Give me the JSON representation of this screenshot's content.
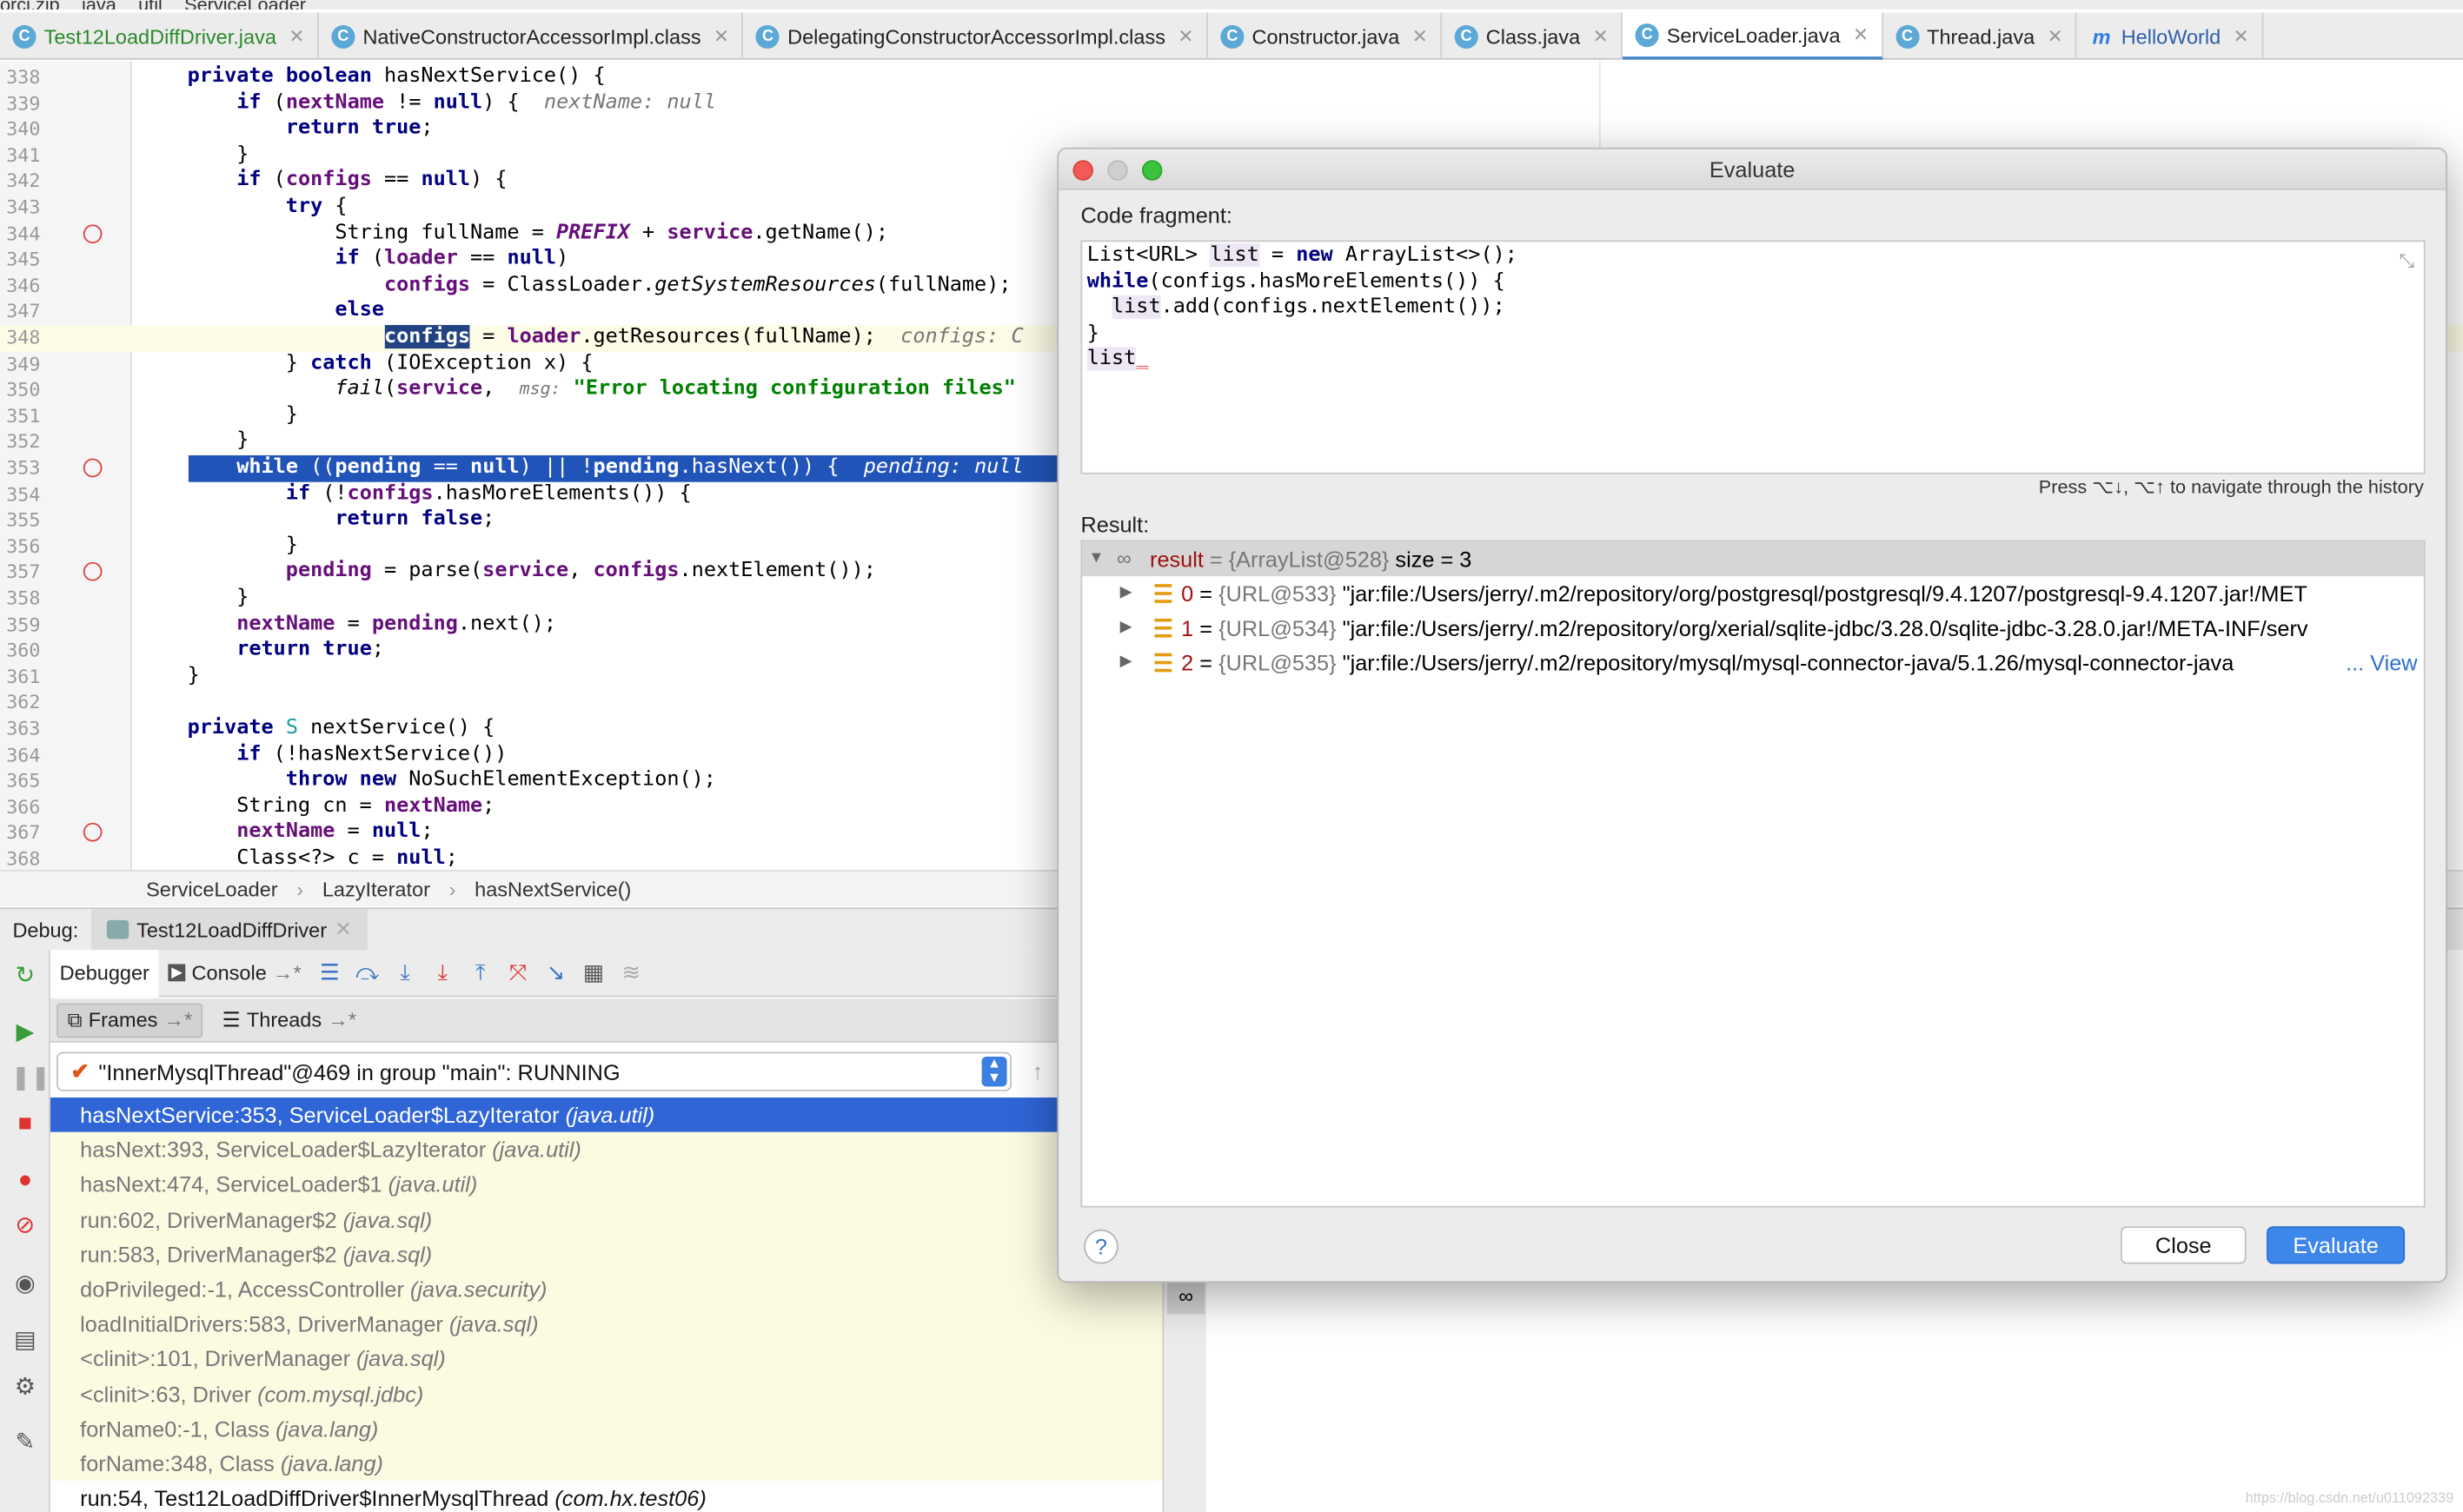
{
  "top_crumbs": [
    "orci.zip",
    "java",
    "util",
    "ServiceLoader"
  ],
  "tabs": [
    {
      "label": "Test12LoadDiffDriver.java",
      "icon": "C",
      "style": "green"
    },
    {
      "label": "NativeConstructorAccessorImpl.class",
      "icon": "C",
      "style": ""
    },
    {
      "label": "DelegatingConstructorAccessorImpl.class",
      "icon": "C",
      "style": ""
    },
    {
      "label": "Constructor.java",
      "icon": "C",
      "style": ""
    },
    {
      "label": "Class.java",
      "icon": "C",
      "style": ""
    },
    {
      "label": "ServiceLoader.java",
      "icon": "C",
      "style": "active"
    },
    {
      "label": "Thread.java",
      "icon": "C",
      "style": ""
    },
    {
      "label": "HelloWorld",
      "icon": "m",
      "style": "blue"
    }
  ],
  "editor": {
    "lines": [
      {
        "n": "338",
        "html": "    <span class='kw'>private boolean</span> hasNextService() {"
      },
      {
        "n": "339",
        "html": "        <span class='kw'>if</span> (<span class='fld'>nextName</span> != <span class='kw'>null</span>) {  <span class='hint'>nextName: null</span>"
      },
      {
        "n": "340",
        "html": "            <span class='kw'>return true</span>;"
      },
      {
        "n": "341",
        "html": "        }"
      },
      {
        "n": "342",
        "html": "        <span class='kw'>if</span> (<span class='fld'>configs</span> == <span class='kw'>null</span>) {"
      },
      {
        "n": "343",
        "html": "            <span class='kw'>try</span> {"
      },
      {
        "n": "344",
        "bp": true,
        "html": "                String fullName = <span class='fld it'>PREFIX</span> + <span class='fld'>service</span>.getName();"
      },
      {
        "n": "345",
        "html": "                <span class='kw'>if</span> (<span class='fld'>loader</span> == <span class='kw'>null</span>)"
      },
      {
        "n": "346",
        "html": "                    <span class='fld'>configs</span> = ClassLoader.<span class='it'>getSystemResources</span>(fullName);"
      },
      {
        "n": "347",
        "html": "                <span class='kw'>else</span>"
      },
      {
        "n": "348",
        "cur": true,
        "html": "                    <span class='fld sel'>configs</span> = <span class='fld'>loader</span>.getResources(fullName);  <span class='hint'>configs: C</span>"
      },
      {
        "n": "349",
        "html": "            } <span class='kw'>catch</span> (IOException x) {"
      },
      {
        "n": "350",
        "html": "                <span class='it'>fail</span>(<span class='fld'>service</span>,  <span class='hint' style='font-size:11px'>msg:</span> <span class='str'>\"Error locating configuration files\"</span>"
      },
      {
        "n": "351",
        "html": "            }"
      },
      {
        "n": "352",
        "html": "        }"
      },
      {
        "n": "353",
        "bp": true,
        "exec": true,
        "html": "        <span class='kw'>while</span> ((<span class='fld'>pending</span> == <span class='kw'>null</span>) || !<span class='fld'>pending</span>.hasNext()) {  <span class='hint'>pending: null</span>"
      },
      {
        "n": "354",
        "html": "            <span class='kw'>if</span> (!<span class='fld'>configs</span>.hasMoreElements()) {"
      },
      {
        "n": "355",
        "html": "                <span class='kw'>return false</span>;"
      },
      {
        "n": "356",
        "html": "            }"
      },
      {
        "n": "357",
        "bp": true,
        "html": "            <span class='fld'>pending</span> = parse(<span class='fld'>service</span>, <span class='fld'>configs</span>.nextElement());"
      },
      {
        "n": "358",
        "html": "        }"
      },
      {
        "n": "359",
        "html": "        <span class='fld'>nextName</span> = <span class='fld'>pending</span>.next();"
      },
      {
        "n": "360",
        "html": "        <span class='kw'>return true</span>;"
      },
      {
        "n": "361",
        "html": "    }"
      },
      {
        "n": "362",
        "html": ""
      },
      {
        "n": "363",
        "html": "    <span class='kw'>private</span> <span style='color:#20999d'>S</span> nextService() {"
      },
      {
        "n": "364",
        "html": "        <span class='kw'>if</span> (!hasNextService())"
      },
      {
        "n": "365",
        "html": "            <span class='kw'>throw new</span> NoSuchElementException();"
      },
      {
        "n": "366",
        "html": "        String cn = <span class='fld'>nextName</span>;"
      },
      {
        "n": "367",
        "bp": true,
        "html": "        <span class='fld'>nextName</span> = <span class='kw'>null</span>;"
      },
      {
        "n": "368",
        "html": "        Class&lt;?&gt; c = <span class='kw'>null</span>;"
      }
    ]
  },
  "breadcrumb": [
    "ServiceLoader",
    "LazyIterator",
    "hasNextService()"
  ],
  "debug": {
    "label": "Debug:",
    "session": "Test12LoadDiffDriver",
    "tab_debugger": "Debugger",
    "tab_console": "Console",
    "frames_tab": "Frames",
    "threads_tab": "Threads",
    "thread": "\"InnerMysqlThread\"@469 in group \"main\": RUNNING",
    "frames": [
      {
        "m": "hasNextService:353, ServiceLoader$LazyIterator",
        "p": "(java.util)"
      },
      {
        "m": "hasNext:393, ServiceLoader$LazyIterator",
        "p": "(java.util)"
      },
      {
        "m": "hasNext:474, ServiceLoader$1",
        "p": "(java.util)"
      },
      {
        "m": "run:602, DriverManager$2",
        "p": "(java.sql)"
      },
      {
        "m": "run:583, DriverManager$2",
        "p": "(java.sql)"
      },
      {
        "m": "doPrivileged:-1, AccessController",
        "p": "(java.security)"
      },
      {
        "m": "loadInitialDrivers:583, DriverManager",
        "p": "(java.sql)"
      },
      {
        "m": "<clinit>:101, DriverManager",
        "p": "(java.sql)"
      },
      {
        "m": "<clinit>:63, Driver",
        "p": "(com.mysql.jdbc)"
      },
      {
        "m": "forName0:-1, Class",
        "p": "(java.lang)"
      },
      {
        "m": "forName:348, Class",
        "p": "(java.lang)"
      },
      {
        "m": "run:54, Test12LoadDiffDriver$InnerMysqlThread",
        "p": "(com.hx.test06)"
      }
    ]
  },
  "dialog": {
    "title": "Evaluate",
    "code_label": "Code fragment:",
    "hint": "Press ⌥↓, ⌥↑ to navigate through the history",
    "result_label": "Result:",
    "result_name": "result",
    "result_value": " = {ArrayList@528}",
    "result_size": "  size = 3",
    "items": [
      {
        "idx": "0",
        "ref": "{URL@533}",
        "val": "\"jar:file:/Users/jerry/.m2/repository/org/postgresql/postgresql/9.4.1207/postgresql-9.4.1207.jar!/MET"
      },
      {
        "idx": "1",
        "ref": "{URL@534}",
        "val": "\"jar:file:/Users/jerry/.m2/repository/org/xerial/sqlite-jdbc/3.28.0/sqlite-jdbc-3.28.0.jar!/META-INF/serv"
      },
      {
        "idx": "2",
        "ref": "{URL@535}",
        "val": "\"jar:file:/Users/jerry/.m2/repository/mysql/mysql-connector-java/5.1.26/mysql-connector-java"
      }
    ],
    "view_link": "... View",
    "help": "?",
    "close": "Close",
    "evaluate": "Evaluate"
  },
  "watermark": "https://blog.csdn.net/u011092339"
}
